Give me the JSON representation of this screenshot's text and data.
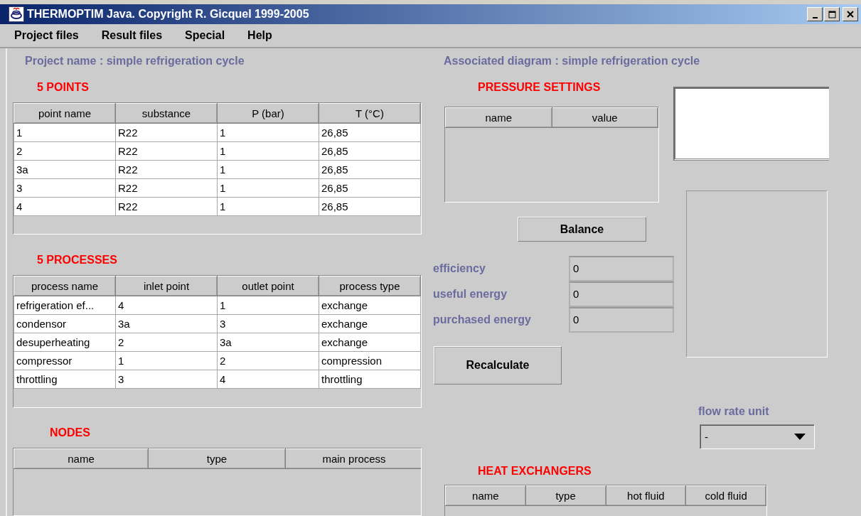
{
  "window": {
    "title": "THERMOPTIM Java. Copyright R. Gicquel 1999-2005"
  },
  "menu": [
    "Project files",
    "Result files",
    "Special",
    "Help"
  ],
  "project_name": "Project name : simple refrigeration cycle",
  "associated_diagram": "Associated diagram : simple refrigeration cycle",
  "points": {
    "title": "5  POINTS",
    "columns": [
      "point name",
      "substance",
      "P (bar)",
      "T (°C)"
    ],
    "rows": [
      [
        "1",
        "R22",
        "1",
        "26,85"
      ],
      [
        "2",
        "R22",
        "1",
        "26,85"
      ],
      [
        "3a",
        "R22",
        "1",
        "26,85"
      ],
      [
        "3",
        "R22",
        "1",
        "26,85"
      ],
      [
        "4",
        "R22",
        "1",
        "26,85"
      ]
    ]
  },
  "processes": {
    "title": "5  PROCESSES",
    "columns": [
      "process name",
      "inlet point",
      "outlet point",
      "process type"
    ],
    "rows": [
      [
        "refrigeration ef...",
        "4",
        "1",
        "exchange"
      ],
      [
        "condensor",
        "3a",
        "3",
        "exchange"
      ],
      [
        "desuperheating",
        "2",
        "3a",
        "exchange"
      ],
      [
        "compressor",
        "1",
        "2",
        "compression"
      ],
      [
        "throttling",
        "3",
        "4",
        "throttling"
      ]
    ]
  },
  "nodes": {
    "title": "NODES",
    "columns": [
      "name",
      "type",
      "main process"
    ]
  },
  "pressure_settings": {
    "title": "PRESSURE SETTINGS",
    "columns": [
      "name",
      "value"
    ]
  },
  "balance_button": "Balance",
  "results": [
    {
      "label": "efficiency",
      "value": "0"
    },
    {
      "label": "useful energy",
      "value": "0"
    },
    {
      "label": "purchased energy",
      "value": "0"
    }
  ],
  "recalculate_button": "Recalculate",
  "flow_rate_unit": {
    "label": "flow rate unit",
    "value": "-"
  },
  "heat_exchangers": {
    "title": "HEAT EXCHANGERS",
    "columns": [
      "name",
      "type",
      "hot fluid",
      "cold fluid"
    ]
  }
}
